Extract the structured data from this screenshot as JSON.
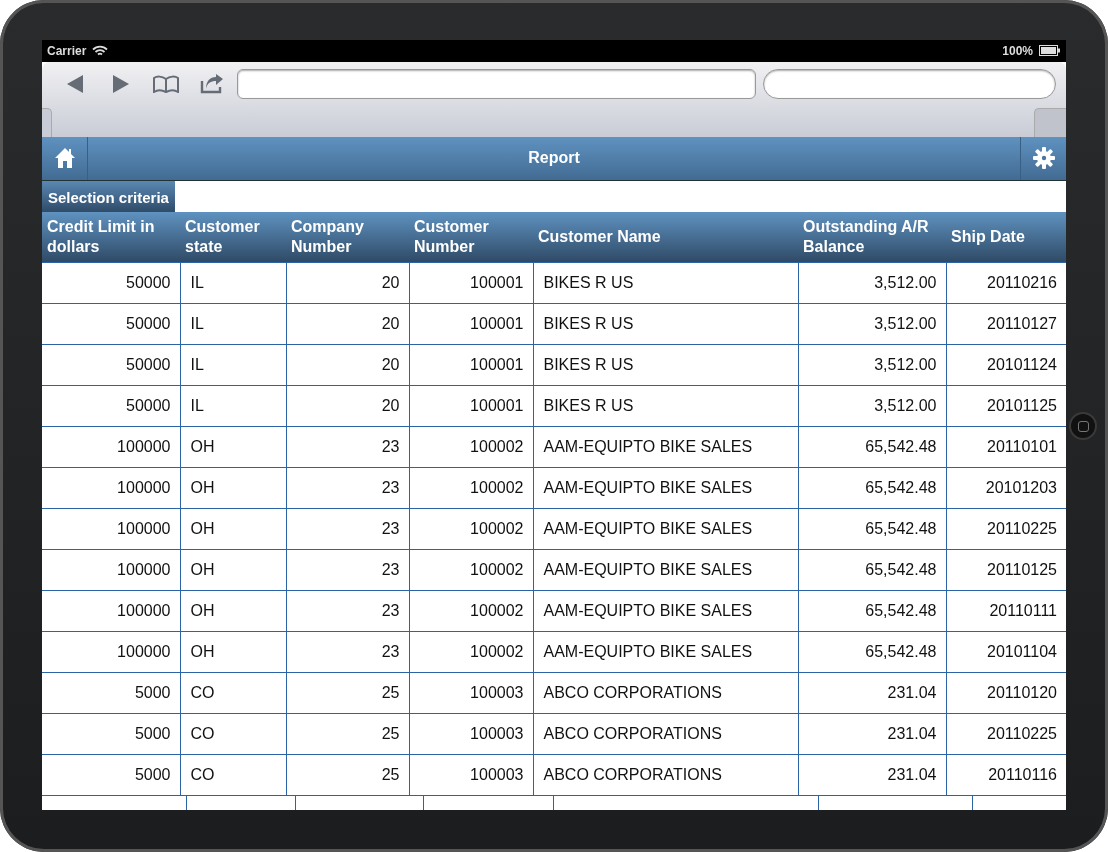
{
  "status_bar": {
    "carrier": "Carrier",
    "battery": "100%"
  },
  "app_header": {
    "title": "Report"
  },
  "tabs": [
    {
      "label": "Selection criteria",
      "selected": true
    }
  ],
  "table": {
    "columns": [
      {
        "label": "Credit Limit in dollars",
        "kind": "number"
      },
      {
        "label": "Customer state",
        "kind": "text"
      },
      {
        "label": "Company Number",
        "kind": "number"
      },
      {
        "label": "Customer Number",
        "kind": "number"
      },
      {
        "label": "Customer Name",
        "kind": "text"
      },
      {
        "label": "Outstanding A/R Balance",
        "kind": "number"
      },
      {
        "label": "Ship Date",
        "kind": "number"
      }
    ],
    "rows": [
      [
        "50000",
        "IL",
        "20",
        "100001",
        "BIKES R US",
        "3,512.00",
        "20110216"
      ],
      [
        "50000",
        "IL",
        "20",
        "100001",
        "BIKES R US",
        "3,512.00",
        "20110127"
      ],
      [
        "50000",
        "IL",
        "20",
        "100001",
        "BIKES R US",
        "3,512.00",
        "20101124"
      ],
      [
        "50000",
        "IL",
        "20",
        "100001",
        "BIKES R US",
        "3,512.00",
        "20101125"
      ],
      [
        "100000",
        "OH",
        "23",
        "100002",
        "AAM-EQUIPTO BIKE SALES",
        "65,542.48",
        "20110101"
      ],
      [
        "100000",
        "OH",
        "23",
        "100002",
        "AAM-EQUIPTO BIKE SALES",
        "65,542.48",
        "20101203"
      ],
      [
        "100000",
        "OH",
        "23",
        "100002",
        "AAM-EQUIPTO BIKE SALES",
        "65,542.48",
        "20110225"
      ],
      [
        "100000",
        "OH",
        "23",
        "100002",
        "AAM-EQUIPTO BIKE SALES",
        "65,542.48",
        "20110125"
      ],
      [
        "100000",
        "OH",
        "23",
        "100002",
        "AAM-EQUIPTO BIKE SALES",
        "65,542.48",
        "20110111"
      ],
      [
        "100000",
        "OH",
        "23",
        "100002",
        "AAM-EQUIPTO BIKE SALES",
        "65,542.48",
        "20101104"
      ],
      [
        "5000",
        "CO",
        "25",
        "100003",
        "ABCO CORPORATIONS",
        "231.04",
        "20110120"
      ],
      [
        "5000",
        "CO",
        "25",
        "100003",
        "ABCO CORPORATIONS",
        "231.04",
        "20110225"
      ],
      [
        "5000",
        "CO",
        "25",
        "100003",
        "ABCO CORPORATIONS",
        "231.04",
        "20110116"
      ]
    ]
  }
}
